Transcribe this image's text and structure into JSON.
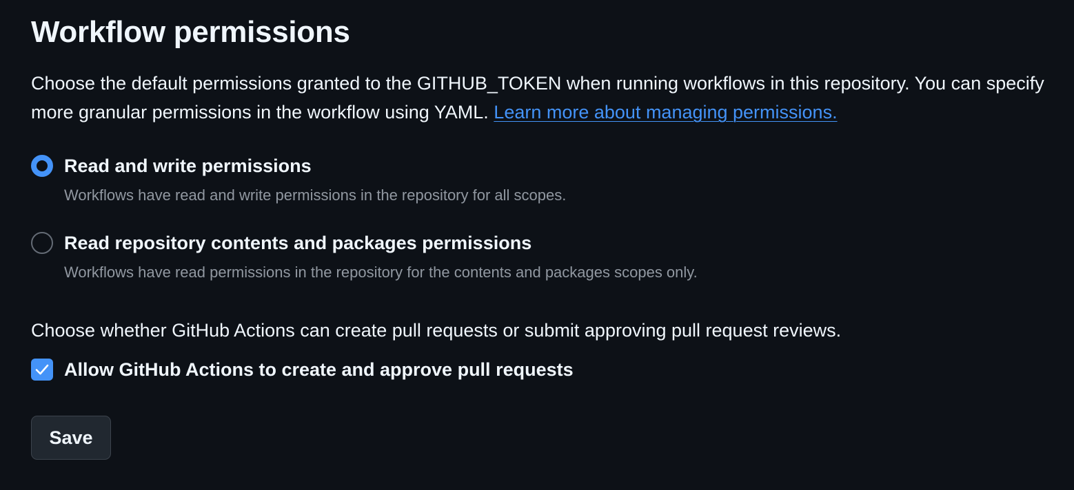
{
  "section": {
    "title": "Workflow permissions",
    "description": "Choose the default permissions granted to the GITHUB_TOKEN when running workflows in this repository. You can specify more granular permissions in the workflow using YAML.",
    "learn_more_link": "Learn more about managing permissions."
  },
  "permission_options": [
    {
      "label": "Read and write permissions",
      "description": "Workflows have read and write permissions in the repository for all scopes.",
      "selected": true
    },
    {
      "label": "Read repository contents and packages permissions",
      "description": "Workflows have read permissions in the repository for the contents and packages scopes only.",
      "selected": false
    }
  ],
  "pull_requests": {
    "question": "Choose whether GitHub Actions can create pull requests or submit approving pull request reviews.",
    "checkbox_label": "Allow GitHub Actions to create and approve pull requests",
    "checked": true
  },
  "save_label": "Save",
  "colors": {
    "background": "#0d1117",
    "accent": "#4493f8",
    "text": "#f0f6fc",
    "muted_text": "#9198a1",
    "button_bg": "#212830",
    "button_border": "#3d444d"
  }
}
